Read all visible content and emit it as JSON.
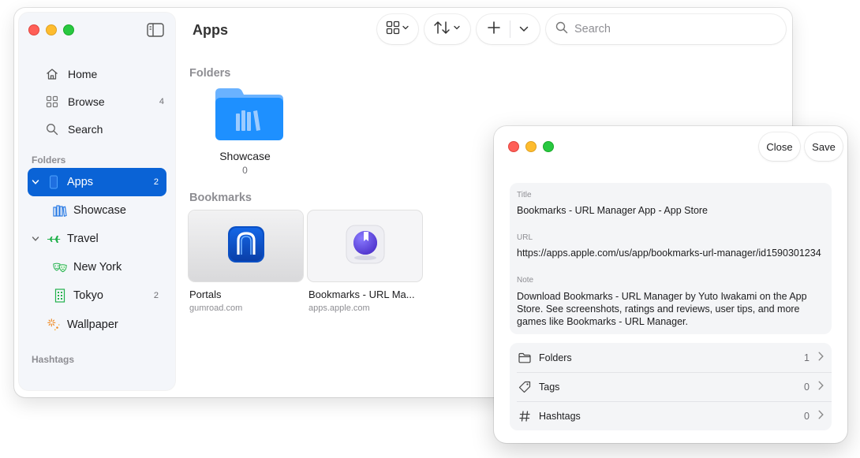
{
  "main": {
    "title": "Apps",
    "search_placeholder": "Search",
    "sections": {
      "folders": "Folders",
      "bookmarks": "Bookmarks"
    },
    "folders": [
      {
        "name": "Showcase",
        "count": "0"
      }
    ],
    "bookmarks": [
      {
        "title": "Portals",
        "domain": "gumroad.com"
      },
      {
        "title": "Bookmarks - URL Ma...",
        "domain": "apps.apple.com"
      }
    ]
  },
  "sidebar": {
    "nav": [
      {
        "label": "Home",
        "icon": "house-icon"
      },
      {
        "label": "Browse",
        "icon": "grid-icon",
        "count": "4"
      },
      {
        "label": "Search",
        "icon": "magnifier-icon"
      }
    ],
    "folders_label": "Folders",
    "folders": [
      {
        "label": "Apps",
        "count": "2",
        "icon": "iphone-icon",
        "selected": true
      },
      {
        "label": "Showcase",
        "icon": "books-icon"
      },
      {
        "label": "Travel",
        "icon": "airplane-icon"
      },
      {
        "label": "New York",
        "icon": "theater-masks-icon"
      },
      {
        "label": "Tokyo",
        "count": "2",
        "icon": "building-icon"
      },
      {
        "label": "Wallpaper",
        "icon": "sparkle-icon"
      }
    ],
    "hashtags_label": "Hashtags"
  },
  "detail": {
    "close_label": "Close",
    "save_label": "Save",
    "title_label": "Title",
    "title_value": "Bookmarks - URL Manager App - App Store",
    "url_label": "URL",
    "url_value": "https://apps.apple.com/us/app/bookmarks-url-manager/id1590301234",
    "note_label": "Note",
    "note_value": "Download Bookmarks - URL Manager by Yuto Iwakami on the App Store. See screenshots, ratings and reviews, user tips, and more games like Bookmarks - URL Manager.",
    "rows": [
      {
        "label": "Folders",
        "value": "1"
      },
      {
        "label": "Tags",
        "value": "0"
      },
      {
        "label": "Hashtags",
        "value": "0"
      }
    ]
  },
  "colors": {
    "accent": "#0a63d6",
    "folder_blue": "#1e90ff",
    "green": "#22b14c"
  }
}
